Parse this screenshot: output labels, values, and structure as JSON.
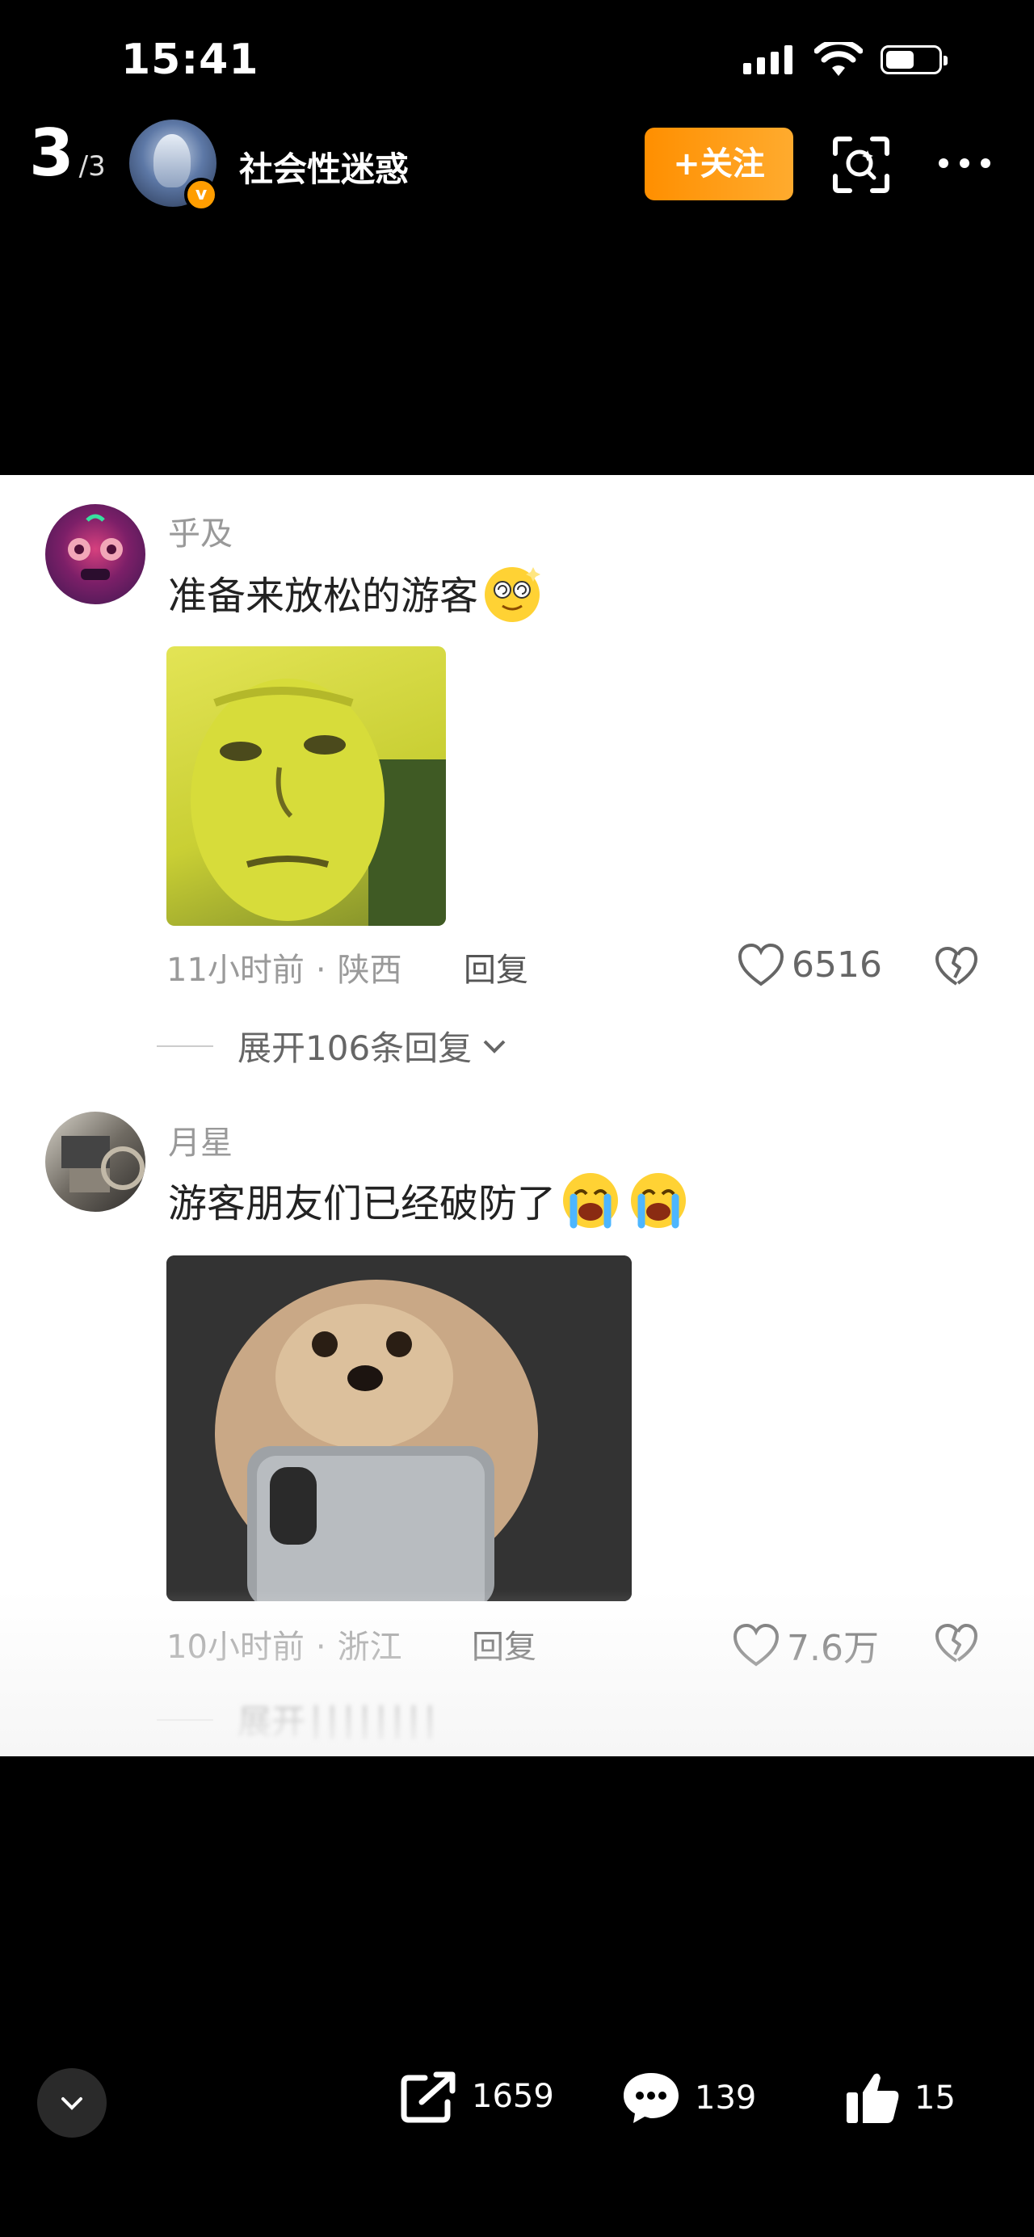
{
  "status_bar": {
    "time": "15:41"
  },
  "header": {
    "page_current": "3",
    "page_separator": "/",
    "page_total": "3",
    "author_name": "社会性迷惑",
    "verified_badge": "v",
    "follow_label": "+关注"
  },
  "comments": [
    {
      "user": "乎及",
      "text": "准备来放松的游客",
      "emoji": "dizzy-face",
      "time": "11小时前",
      "location": "陕西",
      "reply_label": "回复",
      "likes": "6516",
      "expand_label": "展开106条回复"
    },
    {
      "user": "月星",
      "text": "游客朋友们已经破防了",
      "emoji": "loudly-crying-face",
      "time": "10小时前",
      "location": "浙江",
      "reply_label": "回复",
      "likes": "7.6万",
      "expand_label": "展开"
    }
  ],
  "bottom_bar": {
    "shares": "1659",
    "comments": "139",
    "likes": "15"
  },
  "colors": {
    "accent": "#ff9d00",
    "background": "#000000",
    "card": "#ffffff"
  }
}
